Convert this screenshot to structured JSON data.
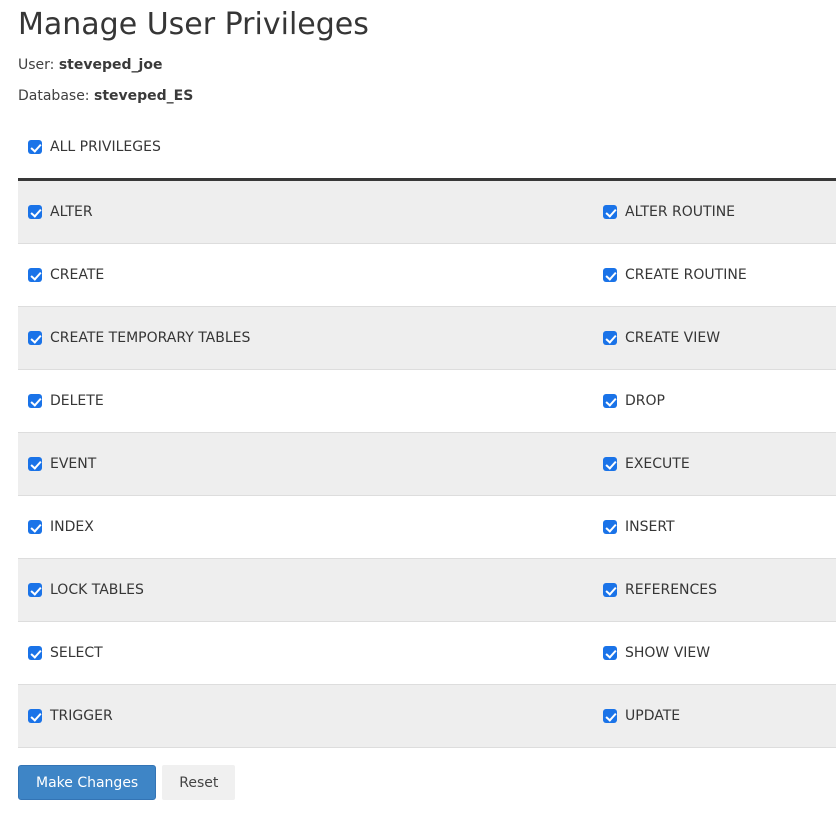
{
  "page": {
    "title": "Manage User Privileges"
  },
  "meta": {
    "user_label": "User:",
    "user_value": "steveped_joe",
    "database_label": "Database:",
    "database_value": "steveped_ES"
  },
  "all_privileges": {
    "label": "ALL PRIVILEGES",
    "checked": true
  },
  "privileges": {
    "all_checked": true,
    "rows": [
      {
        "left": "ALTER",
        "right": "ALTER ROUTINE"
      },
      {
        "left": "CREATE",
        "right": "CREATE ROUTINE"
      },
      {
        "left": "CREATE TEMPORARY TABLES",
        "right": "CREATE VIEW"
      },
      {
        "left": "DELETE",
        "right": "DROP"
      },
      {
        "left": "EVENT",
        "right": "EXECUTE"
      },
      {
        "left": "INDEX",
        "right": "INSERT"
      },
      {
        "left": "LOCK TABLES",
        "right": "REFERENCES"
      },
      {
        "left": "SELECT",
        "right": "SHOW VIEW"
      },
      {
        "left": "TRIGGER",
        "right": "UPDATE"
      }
    ]
  },
  "buttons": {
    "submit": "Make Changes",
    "reset": "Reset"
  },
  "colors": {
    "checkbox_blue": "#1a73e8",
    "button_blue": "#3e85c6",
    "row_stripe": "#eeeeee",
    "table_top_border": "#383838"
  }
}
